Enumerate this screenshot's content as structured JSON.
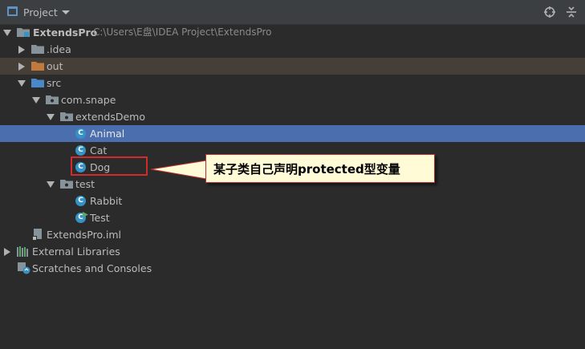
{
  "header": {
    "title": "Project",
    "icons": [
      "project-view-icon",
      "dropdown-caret-icon",
      "locate-target-icon",
      "collapse-all-icon"
    ]
  },
  "tree": {
    "root_label": "ExtendsPro",
    "root_path": "C:\\Users\\E盘\\IDEA Project\\ExtendsPro",
    "idea": ".idea",
    "out": "out",
    "src": "src",
    "package": "com.snape",
    "extendsDemo": "extendsDemo",
    "animal": "Animal",
    "cat": "Cat",
    "dog": "Dog",
    "test": "test",
    "rabbit": "Rabbit",
    "test_class": "Test",
    "iml": "ExtendsPro.iml",
    "external_libraries": "External Libraries",
    "scratches": "Scratches and Consoles"
  },
  "annotation": {
    "text": "某子类自己声明protected型变量"
  },
  "colors": {
    "background": "#2b2b2b",
    "selection": "#4b6eaf",
    "excluded": "#463f37",
    "class_icon": "#3592c4",
    "highlight_border": "#d12b2b",
    "callout_bg": "#fffbd6"
  }
}
